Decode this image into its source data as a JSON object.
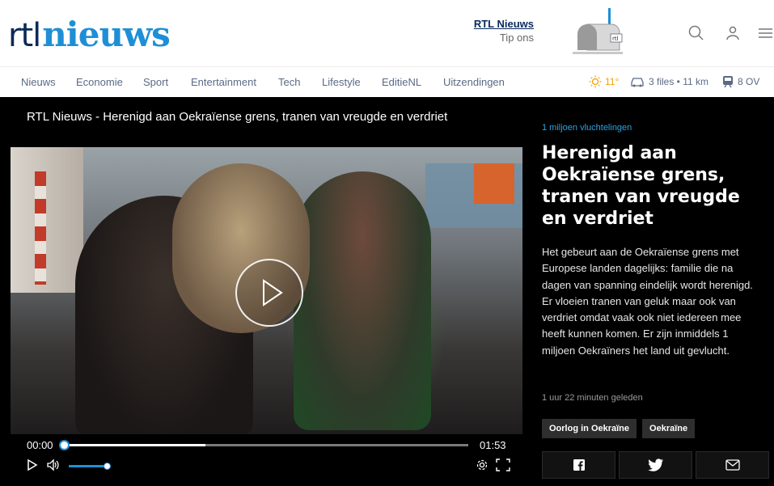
{
  "brand": {
    "logo_part1": "rtl",
    "logo_part2": "nieuws",
    "primary_color": "#0b2a5b",
    "accent_color": "#1e8fd6"
  },
  "header": {
    "tip_title": "RTL Nieuws",
    "tip_subtitle": "Tip ons",
    "icons": [
      "mailbox-icon",
      "search-icon",
      "user-icon",
      "menu-icon"
    ]
  },
  "nav": {
    "items": [
      "Nieuws",
      "Economie",
      "Sport",
      "Entertainment",
      "Tech",
      "Lifestyle",
      "EditieNL",
      "Uitzendingen"
    ],
    "weather": "11°",
    "traffic": "3 files • 11 km",
    "ov": "8 OV"
  },
  "video": {
    "title": "RTL Nieuws - Herenigd aan Oekraïense grens, tranen van vreugde en verdriet",
    "current_time": "00:00",
    "duration": "01:53",
    "buffered_fraction": 0.35,
    "played_fraction": 0.0,
    "volume_fraction": 1.0
  },
  "article": {
    "kicker": "1 miljoen vluchtelingen",
    "headline": "Herenigd aan Oekraïense grens, tranen van vreugde en verdriet",
    "body": "Het gebeurt aan de Oekraïense grens met Europese landen dagelijks: familie die na dagen van spanning eindelijk wordt herenigd. Er vloeien tranen van geluk maar ook van verdriet omdat vaak ook niet iedereen mee heeft kunnen komen. Er zijn inmiddels 1 miljoen Oekraïners het land uit gevlucht.",
    "time_ago": "1 uur 22 minuten geleden",
    "tags": [
      "Oorlog in Oekraïne",
      "Oekraïne"
    ],
    "share": [
      "facebook-icon",
      "twitter-icon",
      "mail-icon"
    ]
  }
}
